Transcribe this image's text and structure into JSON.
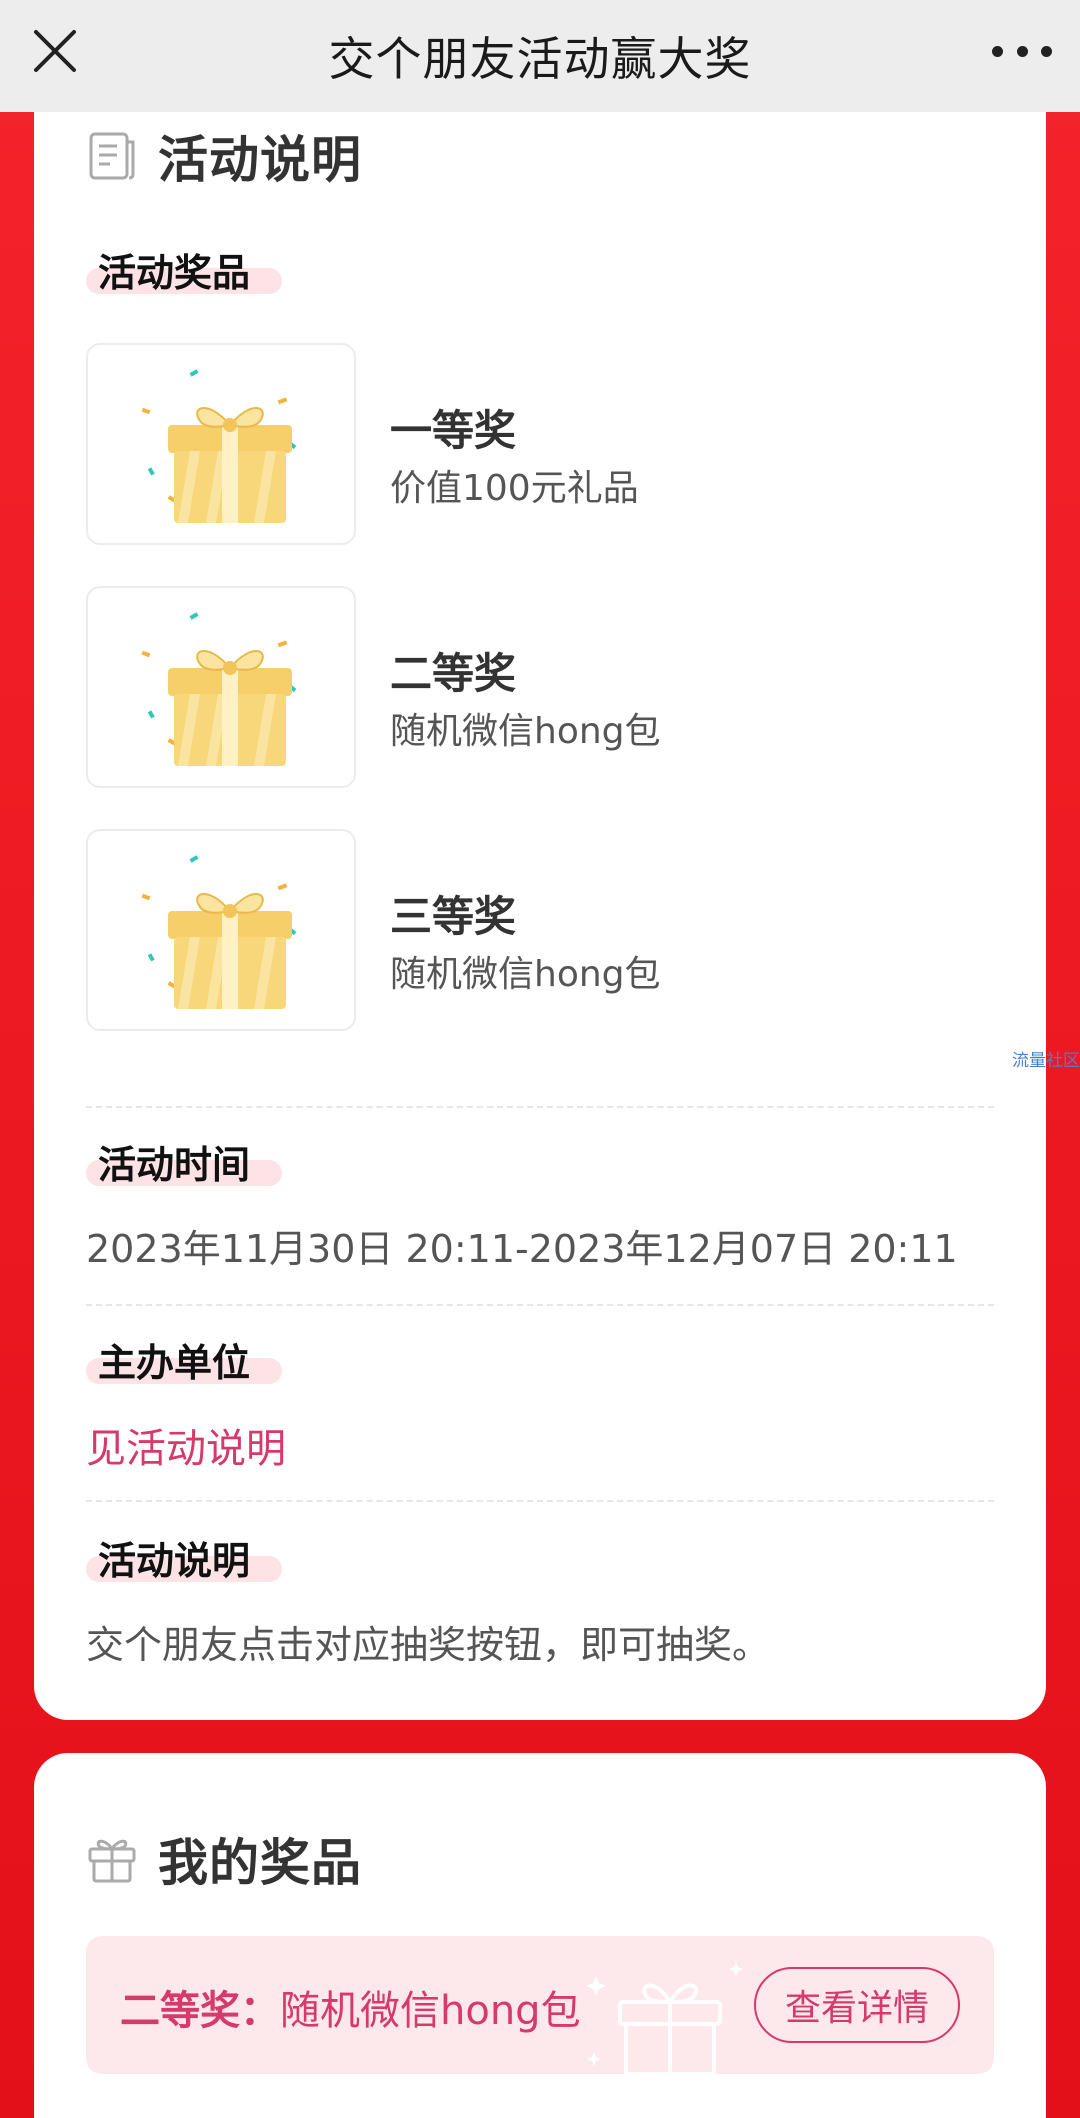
{
  "nav": {
    "title": "交个朋友活动赢大奖"
  },
  "activity": {
    "heading": "活动说明",
    "prizes_label": "活动奖品",
    "prizes": [
      {
        "name": "一等奖",
        "desc": "价值100元礼品"
      },
      {
        "name": "二等奖",
        "desc": "随机微信hong包"
      },
      {
        "name": "三等奖",
        "desc": "随机微信hong包"
      }
    ],
    "time_label": "活动时间",
    "time_value": "2023年11月30日 20:11-2023年12月07日 20:11",
    "organizer_label": "主办单位",
    "organizer_value": "见活动说明",
    "desc_label": "活动说明",
    "desc_value": "交个朋友点击对应抽奖按钮，即可抽奖。"
  },
  "watermark": "流量社区",
  "my_prizes": {
    "heading": "我的奖品",
    "item_level": "二等奖：",
    "item_desc": "随机微信hong包",
    "detail_button": "查看详情"
  },
  "colors": {
    "accent": "#d63a6a",
    "background_red": "#e8141c"
  }
}
